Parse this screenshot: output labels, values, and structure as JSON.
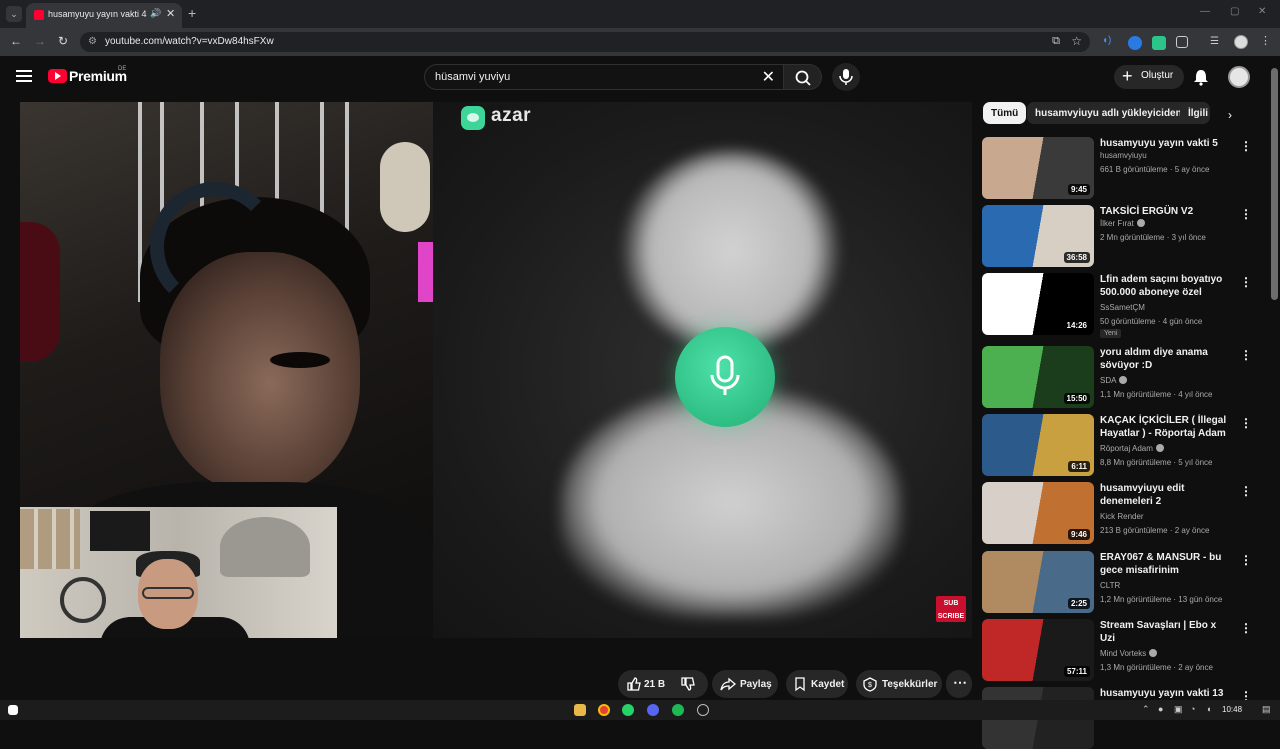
{
  "browser": {
    "tab_title": "husamyuyu yayın vakti 4 -",
    "url": "youtube.com/watch?v=vxDw84hsFXw"
  },
  "masthead": {
    "logo_label": "Premium",
    "region": "DE",
    "search_query": "hüsamvi yuviyu",
    "create_label": "Oluştur"
  },
  "player": {
    "azar_label": "azar",
    "subscribe_line1": "SUB",
    "subscribe_line2": "SCRIBE"
  },
  "actions": {
    "likes": "21 B",
    "share": "Paylaş",
    "save": "Kaydet",
    "thanks": "Teşekkürler"
  },
  "chips": [
    "Tümü",
    "husamvyiuyu adlı yükleyiciden",
    "İlgili"
  ],
  "recommendations": [
    {
      "title": "husamyuyu yayın vakti 5",
      "channel": "husamvyiuyu",
      "meta": "661 B görüntüleme · 5 ay önce",
      "duration": "9:45",
      "verified": false,
      "colors": [
        "#c9a890",
        "#3a3a3a"
      ]
    },
    {
      "title": "TAKSİCİ ERGÜN V2",
      "channel": "İlker Fırat",
      "meta": "2 Mn görüntüleme · 3 yıl önce",
      "duration": "36:58",
      "verified": true,
      "colors": [
        "#2a6ab0",
        "#d8cfc4"
      ]
    },
    {
      "title": "Lfin adem saçını boyatıyo 500.000 aboneye özel",
      "channel": "SsSametÇM",
      "meta": "50 görüntüleme · 4 gün önce",
      "duration": "14:26",
      "verified": false,
      "badge": "Yeni",
      "colors": [
        "#ffffff",
        "#000000"
      ]
    },
    {
      "title": "yoru aldım diye anama sövüyor :D",
      "channel": "SDA",
      "meta": "1,1 Mn görüntüleme · 4 yıl önce",
      "duration": "15:50",
      "verified": true,
      "colors": [
        "#4caf50",
        "#1b3d1b"
      ]
    },
    {
      "title": "KAÇAK İÇKİCİLER ( İllegal Hayatlar ) - Röportaj Adam",
      "channel": "Röportaj Adam",
      "meta": "8,8 Mn görüntüleme · 5 yıl önce",
      "duration": "6:11",
      "verified": true,
      "colors": [
        "#2c5a8a",
        "#c8a040"
      ]
    },
    {
      "title": "husamvyiuyu edit denemeleri 2",
      "channel": "Kick Render",
      "meta": "213 B görüntüleme · 2 ay önce",
      "duration": "9:46",
      "verified": false,
      "colors": [
        "#d8d0c8",
        "#c07030"
      ]
    },
    {
      "title": "ERAY067 & MANSUR - bu gece misafirinim",
      "channel": "CLTR",
      "meta": "1,2 Mn görüntüleme · 13 gün önce",
      "duration": "2:25",
      "verified": false,
      "colors": [
        "#b08a60",
        "#4a6a8a"
      ]
    },
    {
      "title": "Stream Savaşları | Ebo x Uzi",
      "channel": "Mind Vorteks",
      "meta": "1,3 Mn görüntüleme · 2 ay önce",
      "duration": "57:11",
      "verified": true,
      "colors": [
        "#c02828",
        "#1a1a1a"
      ]
    },
    {
      "title": "husamyuyu yayın vakti 13",
      "channel": "",
      "meta": "",
      "duration": "",
      "verified": false,
      "colors": [
        "#333333",
        "#222222"
      ]
    }
  ],
  "taskbar": {
    "time": "10:48"
  }
}
